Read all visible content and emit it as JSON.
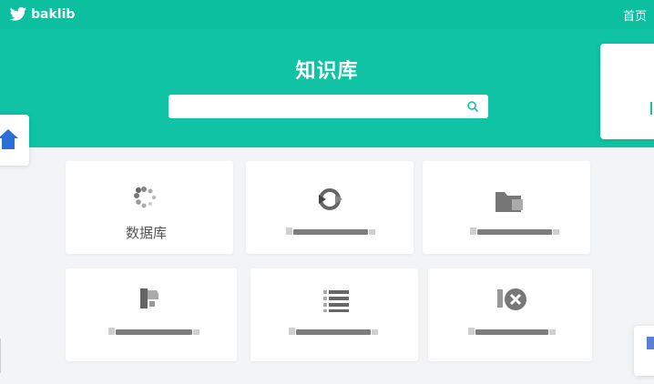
{
  "header": {
    "brand": "baklib",
    "home_link": "首页"
  },
  "hero": {
    "title": "知识库",
    "search_placeholder": ""
  },
  "cards": [
    {
      "icon": "loading-icon",
      "label": "数据库"
    },
    {
      "icon": "sync-icon",
      "label": ""
    },
    {
      "icon": "folder-icon",
      "label": ""
    },
    {
      "icon": "document-icon",
      "label": ""
    },
    {
      "icon": "list-icon",
      "label": ""
    },
    {
      "icon": "close-circle-icon",
      "label": ""
    }
  ],
  "colors": {
    "accent": "#0fc3a4",
    "topbar": "#0bbf9f",
    "background": "#f3f4f6"
  }
}
